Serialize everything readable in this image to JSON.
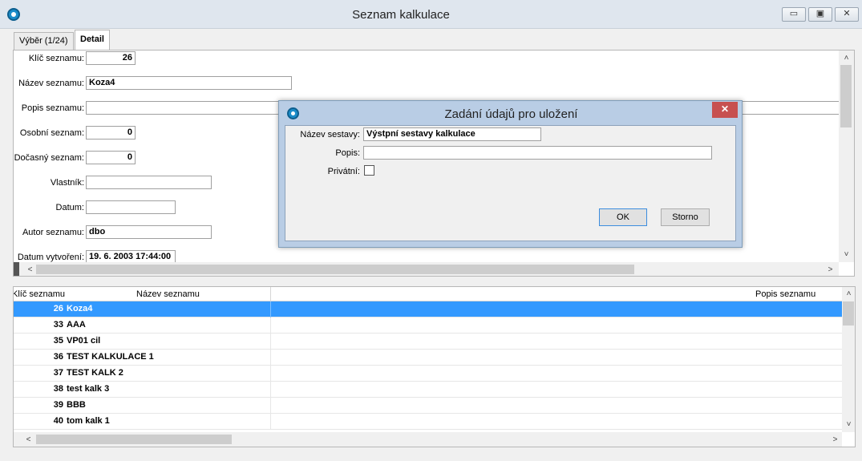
{
  "window": {
    "title": "Seznam kalkulace",
    "min_label": "▭",
    "max_label": "▣",
    "close_label": "✕"
  },
  "tabs": [
    {
      "label": "Výběr (1/24)"
    },
    {
      "label": "Detail"
    }
  ],
  "detail": {
    "fields": [
      {
        "label": "Klíč seznamu:",
        "value": "26"
      },
      {
        "label": "Název seznamu:",
        "value": "Koza4"
      },
      {
        "label": "Popis seznamu:",
        "value": ""
      },
      {
        "label": "Osobní seznam:",
        "value": "0"
      },
      {
        "label": "Dočasný seznam:",
        "value": "0"
      },
      {
        "label": "Vlastník:",
        "value": ""
      },
      {
        "label": "Datum:",
        "value": ""
      },
      {
        "label": "Autor seznamu:",
        "value": "dbo"
      },
      {
        "label": "Datum vytvoření:",
        "value": "19. 6. 2003 17:44:00"
      }
    ]
  },
  "grid": {
    "headers": {
      "key": "Klíč seznamu",
      "name": "Název seznamu",
      "desc": "Popis seznamu"
    },
    "rows": [
      {
        "key": "26",
        "name": "Koza4"
      },
      {
        "key": "33",
        "name": "AAA"
      },
      {
        "key": "35",
        "name": "VP01 cil"
      },
      {
        "key": "36",
        "name": "TEST KALKULACE 1"
      },
      {
        "key": "37",
        "name": "TEST KALK 2"
      },
      {
        "key": "38",
        "name": "test kalk 3"
      },
      {
        "key": "39",
        "name": "BBB"
      },
      {
        "key": "40",
        "name": "tom kalk 1"
      }
    ]
  },
  "dialog": {
    "title": "Zadání údajů pro uložení",
    "close_label": "✕",
    "name_label": "Název sestavy:",
    "name_value": "Výstpní sestavy kalkulace",
    "desc_label": "Popis:",
    "desc_value": "",
    "private_label": "Privátní:",
    "ok_label": "OK",
    "cancel_label": "Storno"
  },
  "scroll": {
    "up": "˄",
    "down": "˅",
    "left": "<",
    "right": ">"
  },
  "colors": {
    "selection": "#3399ff",
    "dialog_frame": "#b9cde5",
    "close_red": "#c75050"
  }
}
